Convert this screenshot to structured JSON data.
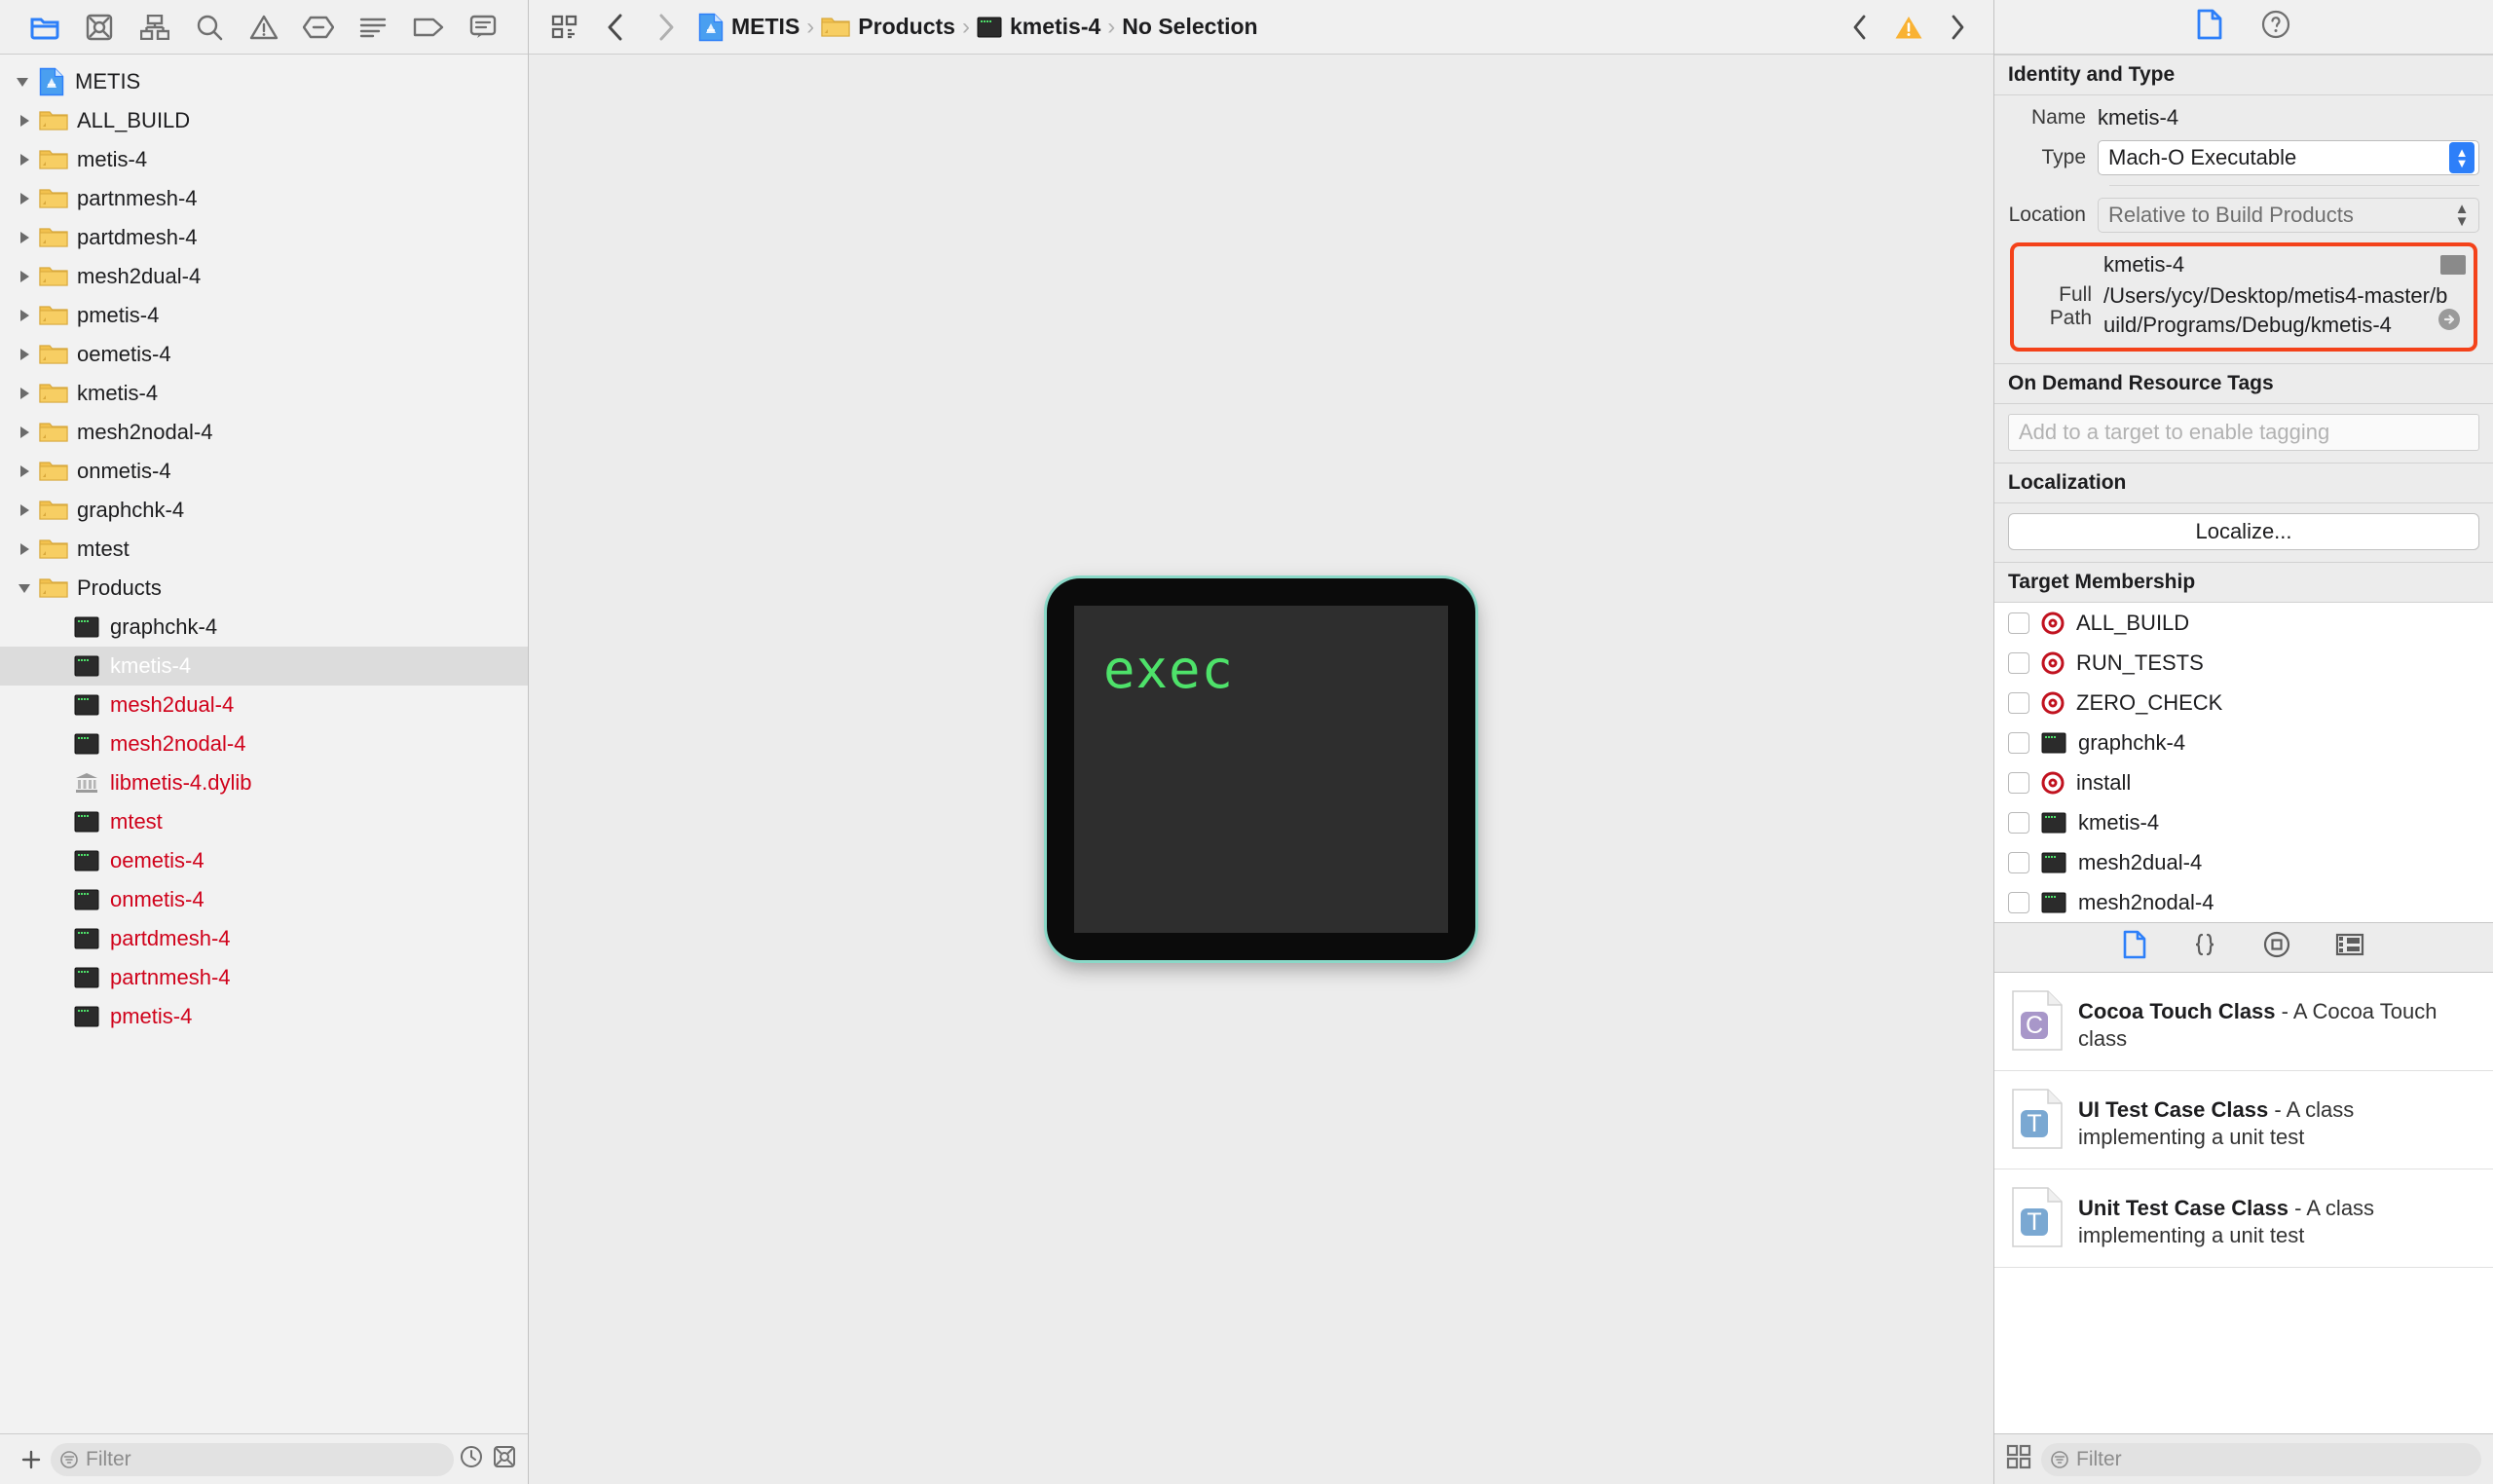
{
  "navigator": {
    "toolbar_icons": [
      "folder-icon",
      "source-control-icon",
      "hierarchy-icon",
      "search-icon",
      "warning-icon",
      "breakpoint-icon",
      "report-icon",
      "tag-icon",
      "comment-icon"
    ],
    "tree": [
      {
        "label": "METIS",
        "indent": 0,
        "icon": "xcode-project-icon",
        "disclosure": "open",
        "color": "black"
      },
      {
        "label": "ALL_BUILD",
        "indent": 1,
        "icon": "folder-icon",
        "disclosure": "closed",
        "color": "black"
      },
      {
        "label": "metis-4",
        "indent": 1,
        "icon": "folder-icon",
        "disclosure": "closed",
        "color": "black"
      },
      {
        "label": "partnmesh-4",
        "indent": 1,
        "icon": "folder-icon",
        "disclosure": "closed",
        "color": "black"
      },
      {
        "label": "partdmesh-4",
        "indent": 1,
        "icon": "folder-icon",
        "disclosure": "closed",
        "color": "black"
      },
      {
        "label": "mesh2dual-4",
        "indent": 1,
        "icon": "folder-icon",
        "disclosure": "closed",
        "color": "black"
      },
      {
        "label": "pmetis-4",
        "indent": 1,
        "icon": "folder-icon",
        "disclosure": "closed",
        "color": "black"
      },
      {
        "label": "oemetis-4",
        "indent": 1,
        "icon": "folder-icon",
        "disclosure": "closed",
        "color": "black"
      },
      {
        "label": "kmetis-4",
        "indent": 1,
        "icon": "folder-icon",
        "disclosure": "closed",
        "color": "black"
      },
      {
        "label": "mesh2nodal-4",
        "indent": 1,
        "icon": "folder-icon",
        "disclosure": "closed",
        "color": "black"
      },
      {
        "label": "onmetis-4",
        "indent": 1,
        "icon": "folder-icon",
        "disclosure": "closed",
        "color": "black"
      },
      {
        "label": "graphchk-4",
        "indent": 1,
        "icon": "folder-icon",
        "disclosure": "closed",
        "color": "black"
      },
      {
        "label": "mtest",
        "indent": 1,
        "icon": "folder-icon",
        "disclosure": "closed",
        "color": "black"
      },
      {
        "label": "Products",
        "indent": 1,
        "icon": "folder-icon",
        "disclosure": "open",
        "color": "black"
      },
      {
        "label": "graphchk-4",
        "indent": 2,
        "icon": "executable-icon",
        "disclosure": "none",
        "color": "black"
      },
      {
        "label": "kmetis-4",
        "indent": 2,
        "icon": "executable-icon",
        "disclosure": "none",
        "color": "white",
        "selected": true
      },
      {
        "label": "mesh2dual-4",
        "indent": 2,
        "icon": "executable-icon",
        "disclosure": "none",
        "color": "red"
      },
      {
        "label": "mesh2nodal-4",
        "indent": 2,
        "icon": "executable-icon",
        "disclosure": "none",
        "color": "red"
      },
      {
        "label": "libmetis-4.dylib",
        "indent": 2,
        "icon": "library-icon",
        "disclosure": "none",
        "color": "red"
      },
      {
        "label": "mtest",
        "indent": 2,
        "icon": "executable-icon",
        "disclosure": "none",
        "color": "red"
      },
      {
        "label": "oemetis-4",
        "indent": 2,
        "icon": "executable-icon",
        "disclosure": "none",
        "color": "red"
      },
      {
        "label": "onmetis-4",
        "indent": 2,
        "icon": "executable-icon",
        "disclosure": "none",
        "color": "red"
      },
      {
        "label": "partdmesh-4",
        "indent": 2,
        "icon": "executable-icon",
        "disclosure": "none",
        "color": "red"
      },
      {
        "label": "partnmesh-4",
        "indent": 2,
        "icon": "executable-icon",
        "disclosure": "none",
        "color": "red"
      },
      {
        "label": "pmetis-4",
        "indent": 2,
        "icon": "executable-icon",
        "disclosure": "none",
        "color": "red"
      }
    ],
    "filter_placeholder": "Filter",
    "add_button": "+"
  },
  "editor": {
    "breadcrumbs": [
      {
        "label": "METIS",
        "icon": "xcode-project-icon"
      },
      {
        "label": "Products",
        "icon": "folder-icon"
      },
      {
        "label": "kmetis-4",
        "icon": "executable-icon"
      },
      {
        "label": "No Selection",
        "icon": "none"
      }
    ],
    "separator": "›",
    "canvas_text": "exec"
  },
  "inspector": {
    "tabs": [
      "file-inspector-icon",
      "quick-help-icon"
    ],
    "identity": {
      "title": "Identity and Type",
      "name_label": "Name",
      "name_value": "kmetis-4",
      "type_label": "Type",
      "type_value": "Mach-O Executable",
      "location_label": "Location",
      "location_value": "Relative to Build Products",
      "file_name": "kmetis-4",
      "full_path_label": "Full Path",
      "full_path_value": "/Users/ycy/Desktop/metis4-master/build/Programs/Debug/kmetis-4",
      "highlight_color": "#f4421a"
    },
    "odr": {
      "title": "On Demand Resource Tags",
      "placeholder": "Add to a target to enable tagging"
    },
    "localization": {
      "title": "Localization",
      "button": "Localize..."
    },
    "target_membership": {
      "title": "Target Membership",
      "items": [
        {
          "label": "ALL_BUILD",
          "icon": "target-icon",
          "checked": false
        },
        {
          "label": "RUN_TESTS",
          "icon": "target-icon",
          "checked": false
        },
        {
          "label": "ZERO_CHECK",
          "icon": "target-icon",
          "checked": false
        },
        {
          "label": "graphchk-4",
          "icon": "executable-icon",
          "checked": false
        },
        {
          "label": "install",
          "icon": "target-icon",
          "checked": false
        },
        {
          "label": "kmetis-4",
          "icon": "executable-icon",
          "checked": false
        },
        {
          "label": "mesh2dual-4",
          "icon": "executable-icon",
          "checked": false
        },
        {
          "label": "mesh2nodal-4",
          "icon": "executable-icon",
          "checked": false
        }
      ]
    },
    "library": {
      "tabs": [
        "file-template-icon",
        "code-snippet-icon",
        "object-library-icon",
        "media-library-icon"
      ],
      "items": [
        {
          "title": "Cocoa Touch Class",
          "desc": " - A Cocoa Touch class",
          "icon": "class-file-icon",
          "letter": "C",
          "color": "#a897c9"
        },
        {
          "title": "UI Test Case Class",
          "desc": " - A class implementing a unit test",
          "icon": "test-file-icon",
          "letter": "T",
          "color": "#7aa8d2"
        },
        {
          "title": "Unit Test Case Class",
          "desc": " - A class implementing a unit test",
          "icon": "test-file-icon",
          "letter": "T",
          "color": "#7aa8d2"
        }
      ],
      "filter_placeholder": "Filter"
    }
  }
}
